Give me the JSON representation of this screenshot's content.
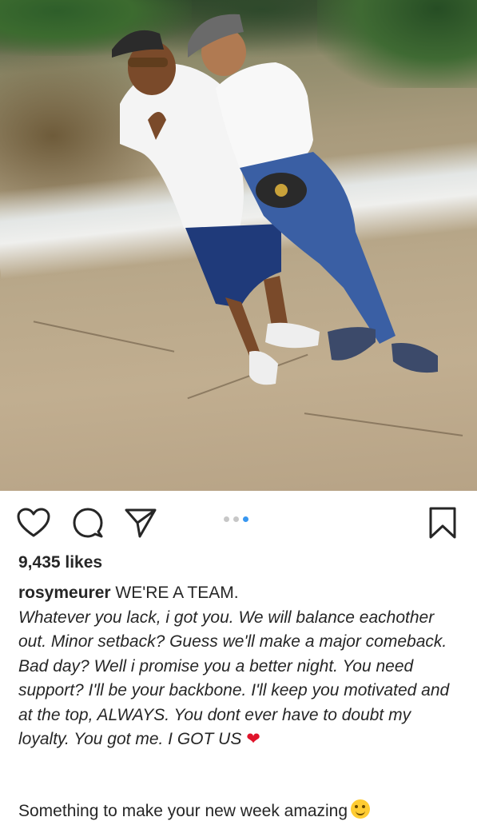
{
  "post": {
    "likes": "9,435 likes",
    "username": "rosymeurer",
    "caption_title": "WE'RE A TEAM.",
    "caption_body": "Whatever you lack, i got you. We will balance eachother out. Minor setback? Guess we'll make a major comeback. Bad day? Well i promise you a better night. You need support? I'll be your backbone. I'll keep you motivated and at the top, ALWAYS. You dont ever have to doubt my loyalty. You got me. I GOT US",
    "caption_emoji": "❤",
    "caption_extra": "Something to make your new week amazing",
    "carousel": {
      "count": 3,
      "active_index": 3
    },
    "icons": [
      "heart-icon",
      "comment-icon",
      "share-icon",
      "bookmark-icon"
    ],
    "colors": {
      "active_dot": "#3897f0",
      "heart_emoji": "#e0142b"
    }
  }
}
